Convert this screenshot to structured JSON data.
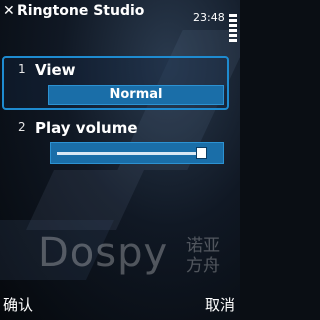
{
  "titlebar": {
    "title": "Ringtone Studio",
    "time": "23:48"
  },
  "settings": [
    {
      "number": "1",
      "label": "View",
      "value": "Normal"
    },
    {
      "number": "2",
      "label": "Play volume",
      "volume_level": 0.95
    }
  ],
  "watermark": {
    "latin": "Dospy",
    "chinese": "诺亚方舟"
  },
  "softkeys": {
    "left": "确认",
    "right": "取消"
  },
  "colors": {
    "accent": "#1e8bd0",
    "value_bg": "#1a6ea8"
  }
}
